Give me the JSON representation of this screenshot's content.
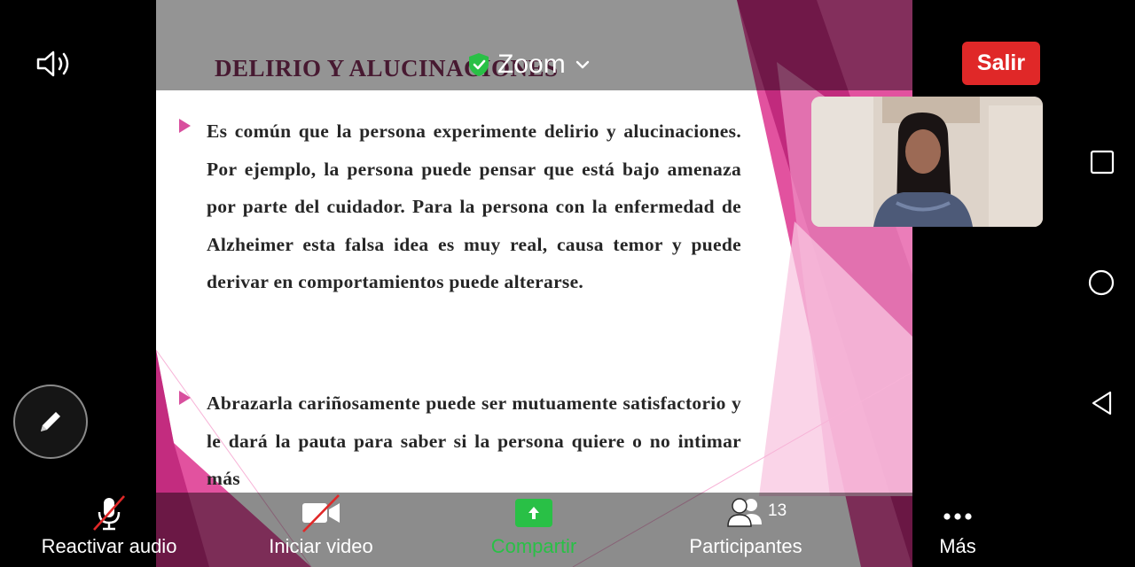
{
  "app": {
    "name": "Zoom"
  },
  "header": {
    "title": "Zoom",
    "exit_label": "Salir",
    "speaker_icon": "speaker-icon",
    "security_icon": "shield-check-icon",
    "dropdown_icon": "chevron-down-icon"
  },
  "slide": {
    "title": "DELIRIO Y ALUCINACIONES",
    "bullets": [
      "Es común que la persona experimente delirio y alucinaciones. Por ejemplo, la persona puede pensar que está bajo amenaza por parte del cuidador. Para la persona con la enfermedad de Alzheimer esta falsa idea es muy real, causa temor y puede derivar en comportamientos puede alterarse.",
      "Abrazarla cariñosamente puede ser mutuamente satisfactorio y le dará la pauta para saber si la persona quiere o no intimar más"
    ]
  },
  "toolbar": {
    "audio_label": "Reactivar audio",
    "video_label": "Iniciar video",
    "share_label": "Compartir",
    "participants_label": "Participantes",
    "participants_count": "13",
    "more_label": "Más"
  },
  "colors": {
    "exit_button": "#e02828",
    "share_green": "#29c046",
    "slide_title": "#7b2b55",
    "slide_pink": "#e2529f"
  }
}
